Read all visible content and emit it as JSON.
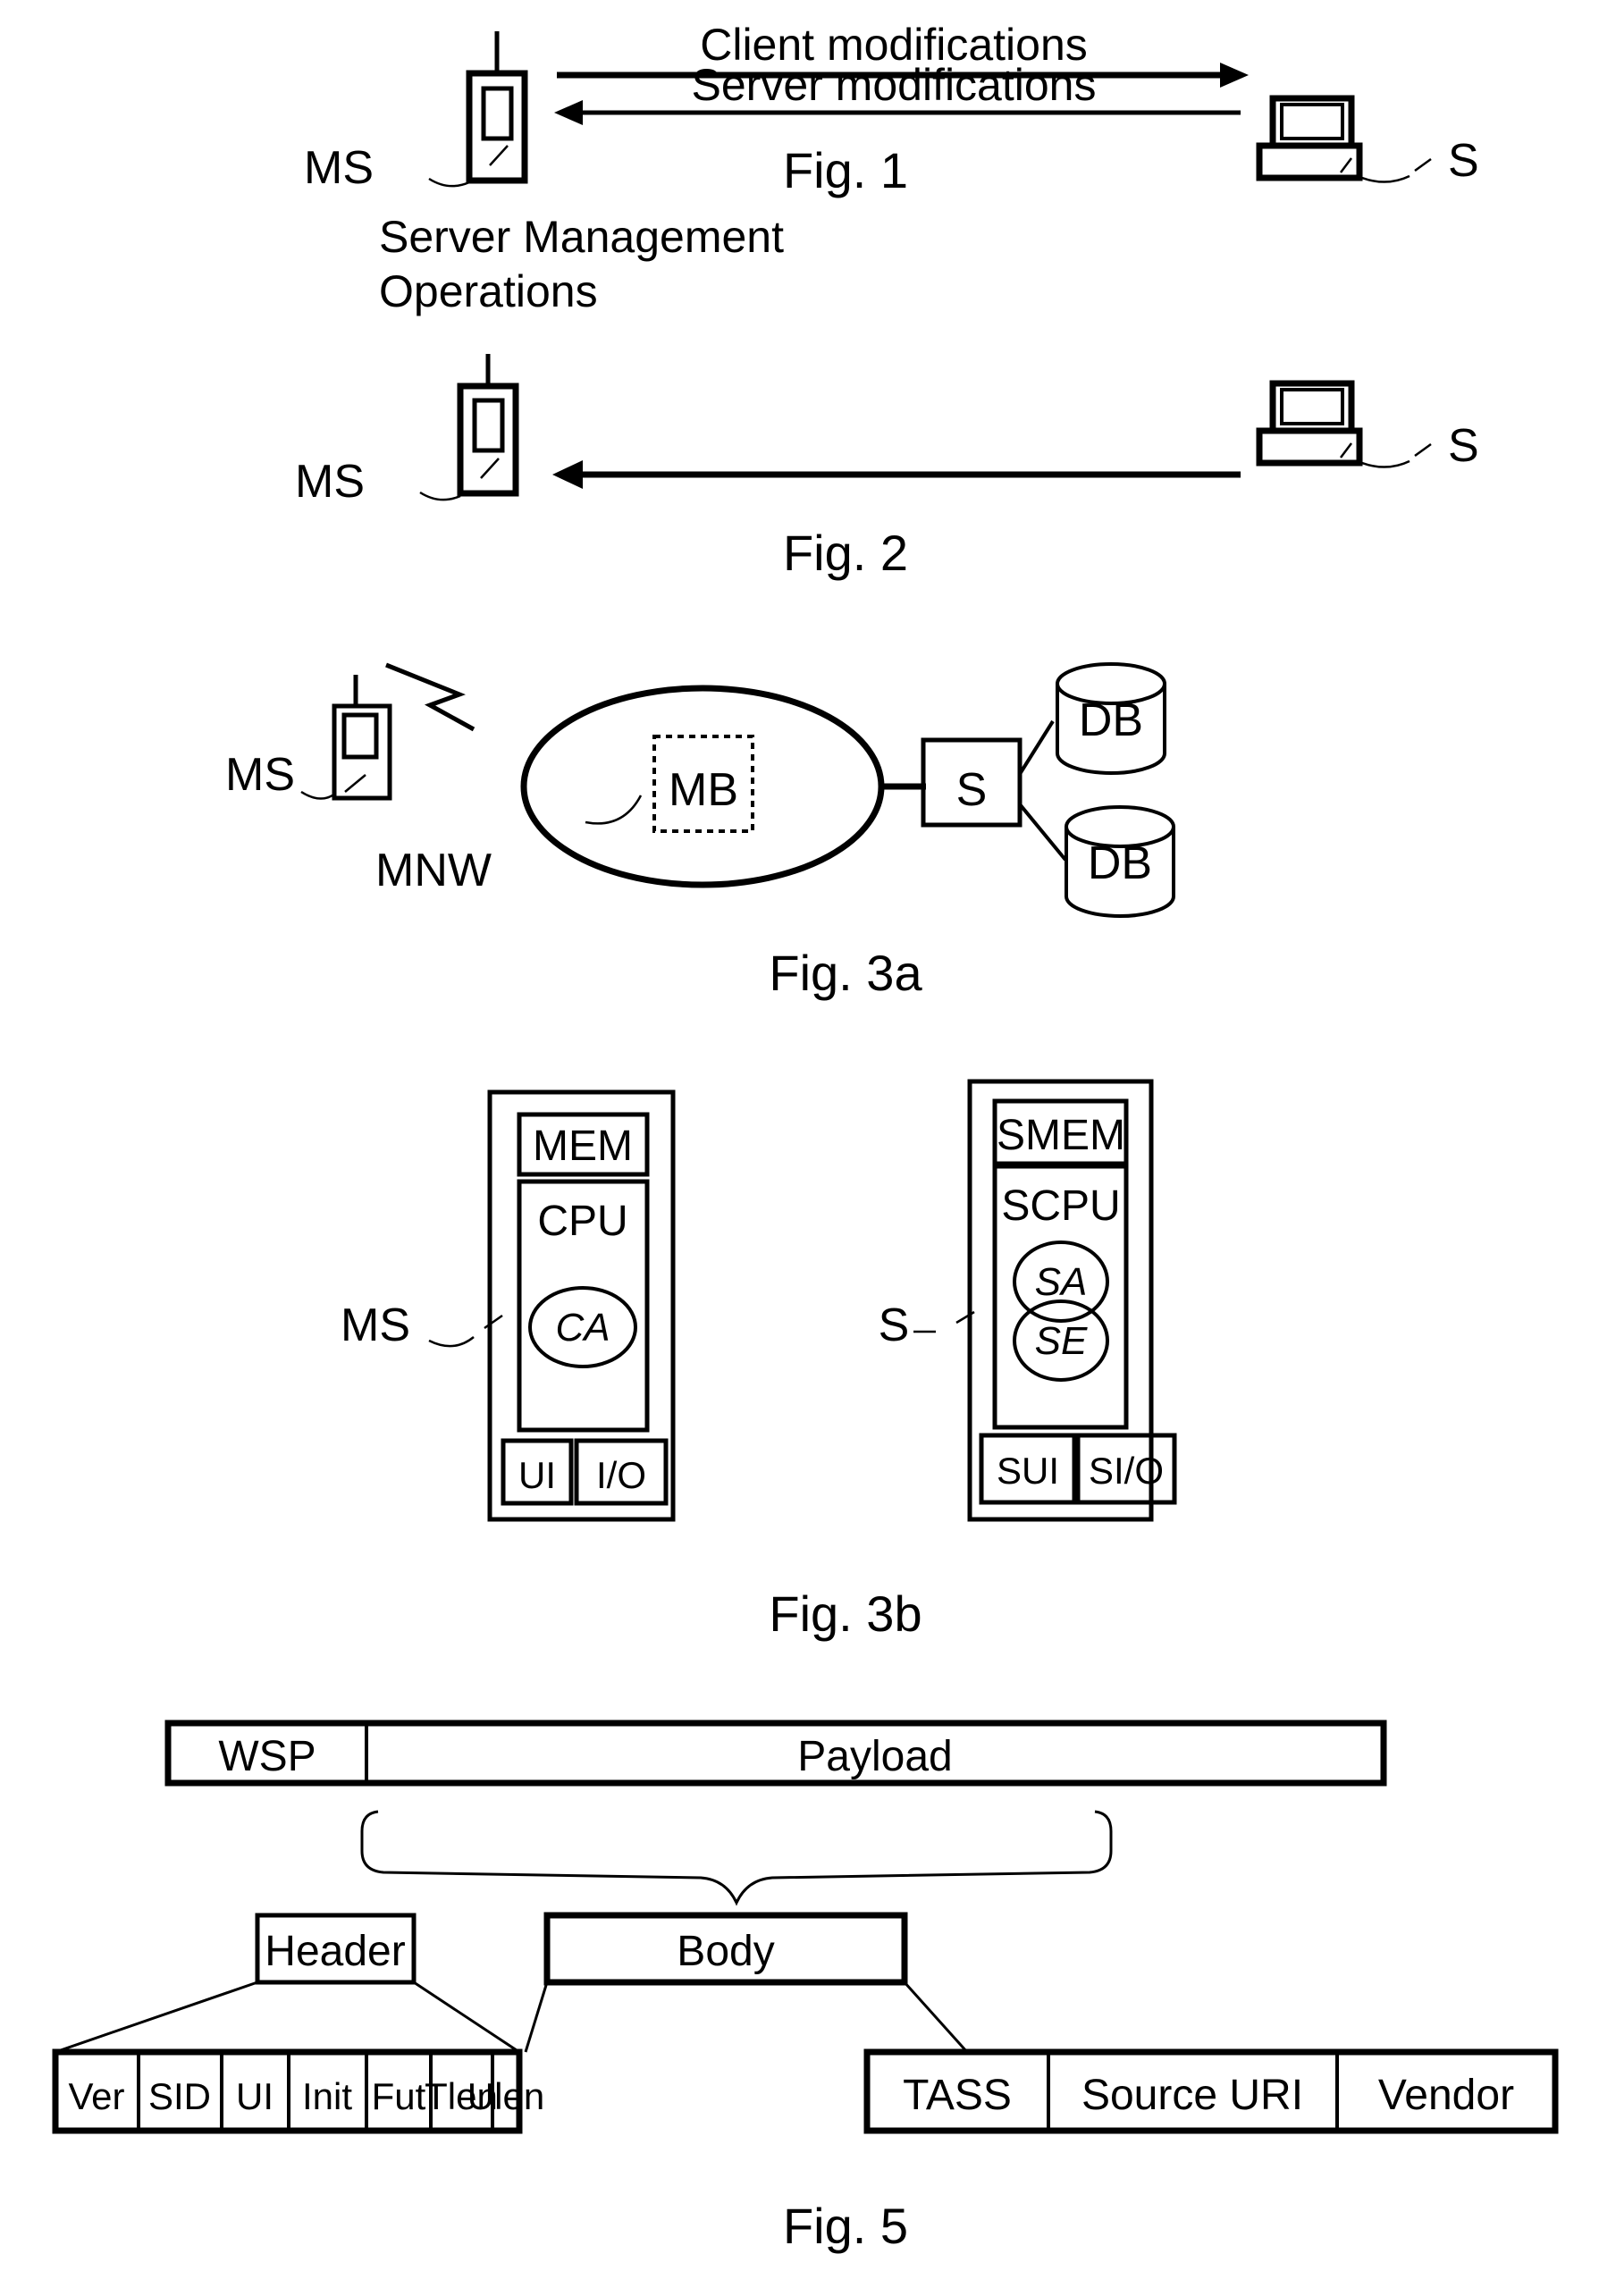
{
  "document": {
    "type": "patent-drawing-sheet",
    "background_color": "#ffffff",
    "ink_color": "#000000"
  },
  "figures": [
    {
      "id": "fig1",
      "caption": "Fig. 1",
      "left_label": "MS",
      "right_label": "S",
      "left_icon": "mobile-station-icon",
      "right_icon": "server-computer-icon",
      "arrows": [
        {
          "label": "Client modifications",
          "direction": "right"
        },
        {
          "label": "Server modifications",
          "direction": "left"
        }
      ]
    },
    {
      "id": "fig2",
      "caption": "Fig. 2",
      "left_label": "MS",
      "right_label": "S",
      "left_icon": "mobile-station-icon",
      "right_icon": "server-computer-icon",
      "arrows": [
        {
          "label_line1": "Server Management",
          "label_line2": "Operations",
          "direction": "left"
        }
      ]
    },
    {
      "id": "fig3a",
      "caption": "Fig. 3a",
      "mobile_label": "MS",
      "network_label": "MNW",
      "network_node_label": "MB",
      "server_label": "S",
      "databases": [
        "DB",
        "DB"
      ],
      "radio_link_icon": "lightning-bolt-icon"
    },
    {
      "id": "fig3b",
      "caption": "Fig. 3b",
      "client": {
        "label": "MS",
        "memory": "MEM",
        "processor": "CPU",
        "agent": "CA",
        "ui": "UI",
        "io": "I/O"
      },
      "server": {
        "label": "S",
        "memory": "SMEM",
        "processor": "SCPU",
        "agents": [
          "SA",
          "SE"
        ],
        "ui": "SUI",
        "io": "SI/O"
      }
    },
    {
      "id": "fig5",
      "caption": "Fig. 5",
      "packet": {
        "protocol_field": "WSP",
        "payload_field": "Payload"
      },
      "header": {
        "title": "Header",
        "fields": [
          "Ver",
          "SID",
          "UI",
          "Init",
          "Fut",
          "Tlen",
          "Ulen"
        ]
      },
      "body": {
        "title": "Body",
        "fields": [
          "TASS",
          "Source URI",
          "Vendor"
        ]
      }
    }
  ]
}
